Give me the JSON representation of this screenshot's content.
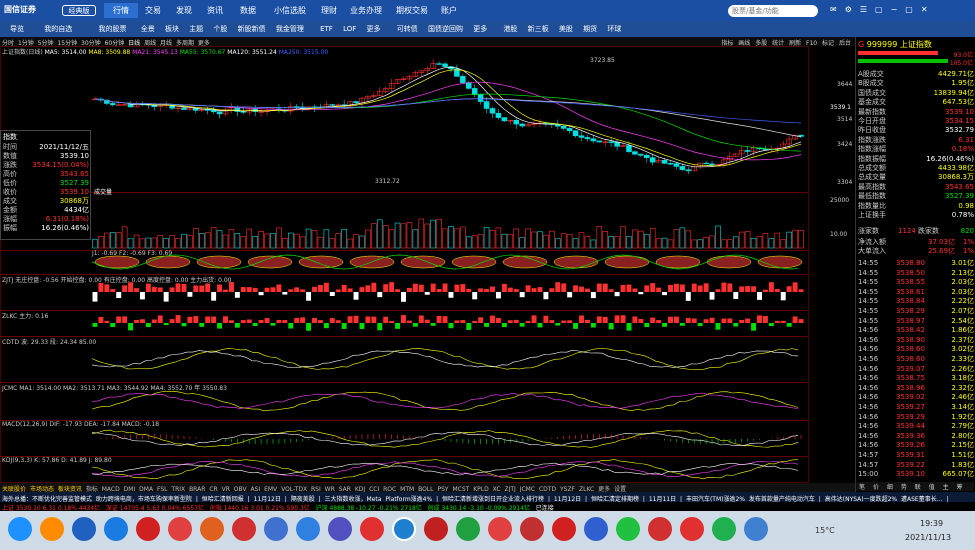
{
  "app": {
    "logo": "国信证券",
    "tabs": [
      "经典版",
      "行情",
      "交易",
      "发现",
      "资讯",
      "数据",
      "小信选股",
      "理财",
      "业务办理",
      "期权交易",
      "账户"
    ],
    "search_placeholder": "股票/基金/功能"
  },
  "toolbar": {
    "items": [
      "导览",
      "我的自选",
      "我的股票",
      "全景",
      "板块",
      "主题",
      "个股",
      "新股新债",
      "我金管理",
      "ETF",
      "LOF",
      "更多",
      "可转债",
      "国债逆回购",
      "更多",
      "港股",
      "新三板",
      "美股",
      "期货",
      "环球"
    ]
  },
  "menu": {
    "periods": [
      "分时",
      "1分钟",
      "5分钟",
      "15分钟",
      "30分钟",
      "60分钟",
      "日线",
      "周线",
      "月线",
      "多周期",
      "更多"
    ],
    "right": [
      "指标",
      "画线",
      "多股",
      "统计",
      "刷新",
      "F10",
      "标记",
      "后台"
    ]
  },
  "main_chart": {
    "title": "上证指数(日线)",
    "ma_labels": [
      "MA5: 3514.00",
      "MA8: 3509.88",
      "MA21: 3545.13",
      "MA55: 3570.67",
      "MA120: 3551.24",
      "MA250: 3515.00"
    ],
    "high_label": "3723.85",
    "low_label": "3312.72",
    "axis_labels": [
      "3644",
      "3539.1",
      "3514",
      "3424",
      "3304"
    ],
    "volume_title": "成交量",
    "volume_axis": [
      "25000",
      "10.00"
    ]
  },
  "infobox": {
    "title": "指数",
    "rows": [
      {
        "l": "时间",
        "v": "2021/11/12/五"
      },
      {
        "l": "数值",
        "v": "3539.10"
      },
      {
        "l": "涨跌",
        "v": "3534.15(0.04%)"
      },
      {
        "l": "高价",
        "v": "3543.65"
      },
      {
        "l": "低价",
        "v": "3527.39"
      },
      {
        "l": "收价",
        "v": "3539.10"
      },
      {
        "l": "成交",
        "v": "30868万"
      },
      {
        "l": "金额",
        "v": "4434亿"
      },
      {
        "l": "涨幅",
        "v": "6.31(0.18%)"
      },
      {
        "l": "振幅",
        "v": "16.26(0.46%)"
      }
    ]
  },
  "panels": [
    {
      "title": "J1: -0.69  F2: -0.69  F3: 0.69"
    },
    {
      "title": "ZJTJ  无庄控盘: -0.56  开始控盘: 0.00  有庄控盘: 0.00  高度控盘: 0.00  主力出货: 0.00"
    },
    {
      "title": "ZLKC  主力: 0.16"
    },
    {
      "title": "CDTD  波: 29.33  段: 24.34   85.00"
    },
    {
      "title": "JCMC  MA1: 3514.00  MA2: 3513.71  MA3: 3544.92  MA4: 3552.70    年 3550.83"
    },
    {
      "title": "MACD(12,26,9)  DIF: -17.93  DEA: -17.84  MACD: -0.18"
    },
    {
      "title": "KDJ(9,3,3)  K: 57.86  D: 41.89  J: 89.80"
    }
  ],
  "tabbar": [
    "关联股价",
    "市场动态",
    "板块资讯",
    "指标",
    "MACD",
    "DMI",
    "DMA",
    "FSL",
    "TRIX",
    "BRAR",
    "CR",
    "VR",
    "OBV",
    "ASI",
    "EMV",
    "VOL-TDX",
    "RSI",
    "WR",
    "SAR",
    "KDJ",
    "CCI",
    "ROC",
    "MTM",
    "BOLL",
    "PSY",
    "MCST",
    "KPLD",
    "XC",
    "ZJTJ",
    "JCMC",
    "CDTD",
    "YSZF",
    "ZLKC",
    "更多",
    "设置"
  ],
  "right_panel": {
    "code": "999999",
    "name": "上证指数",
    "top_values": [
      "93.0亿",
      "105.0亿"
    ],
    "rows1": [
      {
        "l": "A股成交",
        "v": "4429.71亿",
        "c": "yellow"
      },
      {
        "l": "B股成交",
        "v": "1.95亿",
        "c": "yellow"
      },
      {
        "l": "国债成交",
        "v": "13839.94亿",
        "c": "yellow"
      },
      {
        "l": "基金成交",
        "v": "647.53亿",
        "c": "yellow"
      },
      {
        "l": "最新指数",
        "v": "3539.10",
        "c": "red"
      },
      {
        "l": "今日开盘",
        "v": "3534.15",
        "c": "red"
      },
      {
        "l": "昨日收盘",
        "v": "3532.79",
        "c": "white"
      },
      {
        "l": "指数涨跌",
        "v": "6.31",
        "c": "red"
      },
      {
        "l": "指数涨幅",
        "v": "0.18%",
        "c": "red"
      },
      {
        "l": "指数振幅",
        "v": "16.26(0.46%)",
        "c": "white"
      },
      {
        "l": "总成交额",
        "v": "4433.98亿",
        "c": "yellow"
      },
      {
        "l": "总成交量",
        "v": "30868.3万",
        "c": "yellow"
      },
      {
        "l": "最高指数",
        "v": "3543.65",
        "c": "red"
      },
      {
        "l": "最低指数",
        "v": "3527.39",
        "c": "green"
      },
      {
        "l": "指数量比",
        "v": "0.98",
        "c": "yellow"
      },
      {
        "l": "上证换手",
        "v": "0.78%",
        "c": "white"
      }
    ],
    "updown": {
      "up_l": "涨家数",
      "up_v": "1124",
      "down_l": "跌家数",
      "down_v": "820"
    },
    "inflow": [
      {
        "l": "净流入额",
        "v": "37.03亿",
        "p": "1%"
      },
      {
        "l": "大单流入",
        "v": "25.69亿",
        "p": "1%"
      }
    ],
    "ticks": [
      {
        "t": "14:55",
        "p": "3538.80",
        "v": "3.01亿"
      },
      {
        "t": "14:55",
        "p": "3538.50",
        "v": "2.13亿"
      },
      {
        "t": "14:55",
        "p": "3538.55",
        "v": "2.03亿"
      },
      {
        "t": "14:55",
        "p": "3538.61",
        "v": "2.03亿"
      },
      {
        "t": "14:55",
        "p": "3538.84",
        "v": "2.22亿"
      },
      {
        "t": "14:55",
        "p": "3538.29",
        "v": "2.07亿"
      },
      {
        "t": "14:55",
        "p": "3538.97",
        "v": "2.54亿"
      },
      {
        "t": "14:56",
        "p": "3538.42",
        "v": "1.86亿"
      },
      {
        "t": "14:56",
        "p": "3538.90",
        "v": "2.37亿"
      },
      {
        "t": "14:56",
        "p": "3538.60",
        "v": "3.02亿"
      },
      {
        "t": "14:56",
        "p": "3538.60",
        "v": "2.33亿"
      },
      {
        "t": "14:56",
        "p": "3539.07",
        "v": "2.26亿"
      },
      {
        "t": "14:56",
        "p": "3538.75",
        "v": "3.18亿"
      },
      {
        "t": "14:56",
        "p": "3538.96",
        "v": "2.32亿"
      },
      {
        "t": "14:56",
        "p": "3539.02",
        "v": "2.46亿"
      },
      {
        "t": "14:56",
        "p": "3539.27",
        "v": "3.14亿"
      },
      {
        "t": "14:56",
        "p": "3539.29",
        "v": "1.92亿"
      },
      {
        "t": "14:56",
        "p": "3539.44",
        "v": "2.79亿"
      },
      {
        "t": "14:56",
        "p": "3539.36",
        "v": "2.80亿"
      },
      {
        "t": "14:56",
        "p": "3539.26",
        "v": "2.15亿"
      },
      {
        "t": "14:57",
        "p": "3539.31",
        "v": "1.51亿"
      },
      {
        "t": "14:57",
        "p": "3539.22",
        "v": "1.83亿"
      },
      {
        "t": "15:00",
        "p": "3539.10",
        "v": "665.07亿"
      }
    ],
    "bottom_tabs": [
      "笔",
      "价",
      "细",
      "势",
      "联",
      "值",
      "主",
      "筹"
    ]
  },
  "news": [
    "海外总播：不断优化完善监管模式  助力跨境电商，市场车购保率新型院",
    "恒哈汇清新回报  | 11月12日",
    "隔夜美股 | 三大指数收涨，Meta Platform涨逾4%",
    "恒哈汇清新增涨到日开企业流入排行榜 | 11月12日",
    "恒哈汇清定排期榜 | 11月11日",
    "丰田汽车(TM)涨逾2% 发布首款量产纯电动汽车",
    "高伟达(NYSA)一度跌超2% 遭ASE董事长…"
  ],
  "status": {
    "sh": "上证 3539.10  6.31  0.18%  4434亿",
    "sz": "深证 14705.4  5.63  0.04%  6557亿",
    "cyb": "创指 1440.16  3.01  0.21%  590.3亿",
    "hs": "沪深 4888.38  -10.27  -0.21%  2718亿",
    "kc": "创成 3430.14  -3.10  -0.09%  2914亿",
    "conn": "已连接"
  },
  "taskbar": {
    "temp": "15°C",
    "time": "19:39",
    "date": "2021/11/13"
  },
  "colors": {
    "up": "#ff3030",
    "down": "#00e000",
    "bg": "#000000",
    "title_bar": "#1a4fa3"
  }
}
